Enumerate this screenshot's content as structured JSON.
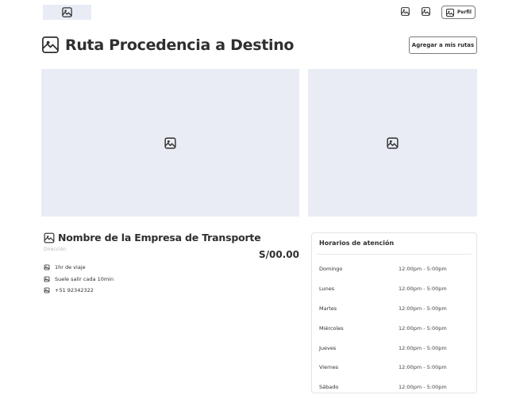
{
  "header": {
    "logo_icon": "image-icon",
    "nav_icons": [
      "image-icon",
      "image-icon"
    ],
    "profile_label": "Perfil"
  },
  "route": {
    "title": "Ruta Procedencia a Destino",
    "add_button_label": "Agregar a mis rutas"
  },
  "company": {
    "name": "Nombre de la Empresa de Transporte",
    "address_placeholder": "Dirección",
    "price": "S/00.00",
    "details": [
      {
        "icon": "image-icon",
        "text": "1hr de viaje"
      },
      {
        "icon": "image-icon",
        "text": "Suele salir cada 10min"
      },
      {
        "icon": "image-icon",
        "text": "+51 92342322"
      }
    ]
  },
  "hours": {
    "title": "Horarios de atención",
    "rows": [
      {
        "day": "Domingo",
        "time": "12:00pm - 5:00pm"
      },
      {
        "day": "Lunes",
        "time": "12:00pm - 5:00pm"
      },
      {
        "day": "Martes",
        "time": "12:00pm - 5:00pm"
      },
      {
        "day": "Miércoles",
        "time": "12:00pm - 5:00pm"
      },
      {
        "day": "Jueves",
        "time": "12:00pm - 5:00pm"
      },
      {
        "day": "Viernes",
        "time": "12:00pm - 5:00pm"
      },
      {
        "day": "Sábado",
        "time": "12:00pm - 5:00pm"
      }
    ]
  },
  "colors": {
    "placeholder_bg": "#e9ecf5",
    "text": "#2f2f2f",
    "border": "#7a7a7a"
  }
}
